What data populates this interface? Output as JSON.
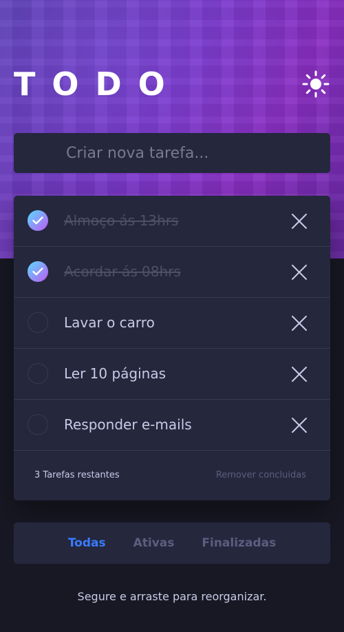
{
  "header": {
    "title": "TODO",
    "theme_icon": "sun-icon"
  },
  "new_todo": {
    "placeholder": "Criar nova tarefa..."
  },
  "todos": [
    {
      "text": "Almoço ás 13hrs",
      "completed": true
    },
    {
      "text": "Acordar ás 08hrs",
      "completed": true
    },
    {
      "text": "Lavar o carro",
      "completed": false
    },
    {
      "text": "Ler 10 páginas",
      "completed": false
    },
    {
      "text": "Responder e-mails",
      "completed": false
    }
  ],
  "footer": {
    "remaining": "3 Tarefas restantes",
    "clear_completed": "Remover concluidas"
  },
  "filters": {
    "all": "Todas",
    "active": "Ativas",
    "completed": "Finalizadas",
    "selected": "all"
  },
  "hint": "Segure e arraste para reorganizar.",
  "colors": {
    "accent": "#3a7bfd",
    "check_gradient_start": "#57ddff",
    "check_gradient_end": "#c058f3",
    "card": "#25273d",
    "background": "#181824"
  }
}
